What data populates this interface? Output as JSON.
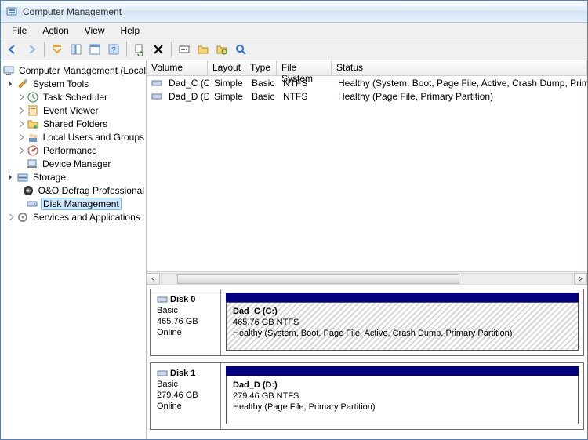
{
  "window": {
    "title": "Computer Management"
  },
  "menu": {
    "file": "File",
    "action": "Action",
    "view": "View",
    "help": "Help"
  },
  "tree": {
    "root": "Computer Management (Local)",
    "system_tools": "System Tools",
    "task_scheduler": "Task Scheduler",
    "event_viewer": "Event Viewer",
    "shared_folders": "Shared Folders",
    "local_users": "Local Users and Groups",
    "performance": "Performance",
    "device_manager": "Device Manager",
    "storage": "Storage",
    "defrag": "O&O Defrag Professional",
    "disk_mgmt": "Disk Management",
    "services": "Services and Applications"
  },
  "columns": {
    "volume": "Volume",
    "layout": "Layout",
    "type": "Type",
    "fs": "File System",
    "status": "Status"
  },
  "volumes": [
    {
      "name": "Dad_C (C:)",
      "layout": "Simple",
      "type": "Basic",
      "fs": "NTFS",
      "status": "Healthy (System, Boot, Page File, Active, Crash Dump, Primary Partition)"
    },
    {
      "name": "Dad_D (D:)",
      "layout": "Simple",
      "type": "Basic",
      "fs": "NTFS",
      "status": "Healthy (Page File, Primary Partition)"
    }
  ],
  "disks": [
    {
      "name": "Disk 0",
      "type": "Basic",
      "size": "465.76 GB",
      "state": "Online",
      "partition": {
        "name": "Dad_C  (C:)",
        "detail": "465.76 GB NTFS",
        "status": "Healthy (System, Boot, Page File, Active, Crash Dump, Primary Partition)",
        "hatched": true
      }
    },
    {
      "name": "Disk 1",
      "type": "Basic",
      "size": "279.46 GB",
      "state": "Online",
      "partition": {
        "name": "Dad_D  (D:)",
        "detail": "279.46 GB NTFS",
        "status": "Healthy (Page File, Primary Partition)",
        "hatched": false
      }
    }
  ]
}
